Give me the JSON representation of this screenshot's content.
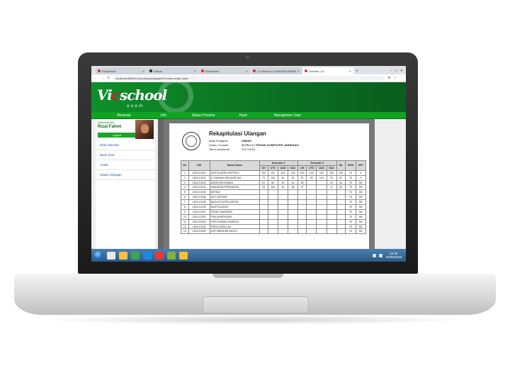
{
  "browser": {
    "tabs": [
      {
        "label": "RizaFahmi",
        "fav_color": "#d93025",
        "active": false
      },
      {
        "label": "Github",
        "fav_color": "#24292e",
        "active": false
      },
      {
        "label": "RizaFahmi",
        "fav_color": "#d93025",
        "active": false
      },
      {
        "label": "| Vi School | UJIANGAN BERB/",
        "fav_color": "#d93025",
        "active": false
      },
      {
        "label": "Sekolah | Vi...",
        "fav_color": "#d93025",
        "active": true
      }
    ],
    "url": "localhost:8080/vi-school/panel/pages/?modul=cetak_hasil",
    "new_tab": "+"
  },
  "site": {
    "logo_main": "Vi",
    "logo_c": "c",
    "logo_rest": "school",
    "logo_sub": "exam",
    "menu": [
      "Beranda",
      "Info",
      "Status Peserta",
      "Hasil",
      "Manajemen User"
    ]
  },
  "sidebar": {
    "role": "Administrator",
    "name": "Rizal Fahmi",
    "logout": "Logout",
    "items": [
      "Data Sekolah",
      "Bank Soal",
      "Cetak",
      "Status Ulangan"
    ]
  },
  "report": {
    "title": "Rekapitulasi Ulangan",
    "meta": [
      {
        "key": "Mata Pelajaran",
        "value": "SIMDIG"
      },
      {
        "key": "Kelas | Jurusan",
        "value": "XI-TKJ-1 | TEKNIK KOMPUTER JARINGAN"
      },
      {
        "key": "Tahun Akademik",
        "value": "2017/2018"
      }
    ],
    "head1": {
      "no": "No",
      "nis": "NIS",
      "nama": "Nama Siswa",
      "s1": "Semester 1",
      "s2": "Semester 2",
      "na": "NA",
      "kkm": "KKM",
      "ket": "KET"
    },
    "head2": [
      "UH",
      "UTS",
      "UAS",
      "NA1",
      "UH",
      "UTS",
      "UAS",
      "NA2"
    ],
    "rows": [
      [
        "1",
        "1516.10100",
        "ADITYA ADEN SEPTIAJI",
        "100",
        "100",
        "100",
        "100",
        "100",
        "100",
        "100",
        "100",
        "100",
        "75",
        "K"
      ],
      [
        "2",
        "1516.10101",
        "A. RIDWAN ARDIANSYAH",
        "73",
        "100",
        "50",
        "62",
        "67",
        "60",
        "100",
        "92",
        "67",
        "75",
        "K"
      ],
      [
        "3",
        "1516.10102",
        "AIDATURROHMAH",
        "67",
        "60",
        "60",
        "62",
        "80",
        "",
        "",
        "24",
        "43",
        "75",
        "BK"
      ],
      [
        "4",
        "1516.10104",
        "ANGGESA FERDIANITA",
        "33",
        "100",
        "40",
        "56",
        "27",
        "",
        "",
        "8",
        "32",
        "75",
        "BK"
      ],
      [
        "5",
        "1516.10105",
        "ARYANI",
        "",
        "",
        "",
        "",
        "",
        "",
        "",
        "",
        "",
        "75",
        "BK"
      ],
      [
        "6",
        "1516.10106",
        "AYU LESTARI",
        "",
        "",
        "",
        "",
        "",
        "",
        "",
        "",
        "",
        "75",
        "BK"
      ],
      [
        "7",
        "1516.10196",
        "BAGUS PUTRO ARIFIN",
        "",
        "",
        "",
        "",
        "",
        "",
        "",
        "",
        "",
        "75",
        "BK"
      ],
      [
        "8",
        "1516.10195",
        "DIAH FAUZIAH",
        "",
        "",
        "",
        "",
        "",
        "",
        "",
        "",
        "",
        "75",
        "BK"
      ],
      [
        "9",
        "1516.10201",
        "FENNY ANDRIENI",
        "",
        "",
        "",
        "",
        "",
        "",
        "",
        "",
        "",
        "75",
        "BK"
      ],
      [
        "10",
        "1516.10202",
        "FIKA NURFIKRAH",
        "",
        "",
        "",
        "",
        "",
        "",
        "",
        "",
        "",
        "75",
        "BK"
      ],
      [
        "11",
        "1516.10203",
        "FIKRI AHMAD FAHROZI",
        "",
        "",
        "",
        "",
        "",
        "",
        "",
        "",
        "",
        "75",
        "BK"
      ],
      [
        "12",
        "1516.10204",
        "FIRDA FADILLAH",
        "",
        "",
        "",
        "",
        "",
        "",
        "",
        "",
        "",
        "75",
        "BK"
      ],
      [
        "13",
        "1516.10205",
        "HAFI IBRAHIM SALEH",
        "",
        "",
        "",
        "",
        "",
        "",
        "",
        "",
        "",
        "75",
        "BK"
      ]
    ]
  },
  "taskbar": {
    "clock_time": "10:36",
    "clock_date": "22/05/2018",
    "apps": [
      "#e8e8e8",
      "#f4c242",
      "#3aa655",
      "#1e88e5",
      "#e53935",
      "#7cb342",
      "#fbc02d"
    ]
  }
}
